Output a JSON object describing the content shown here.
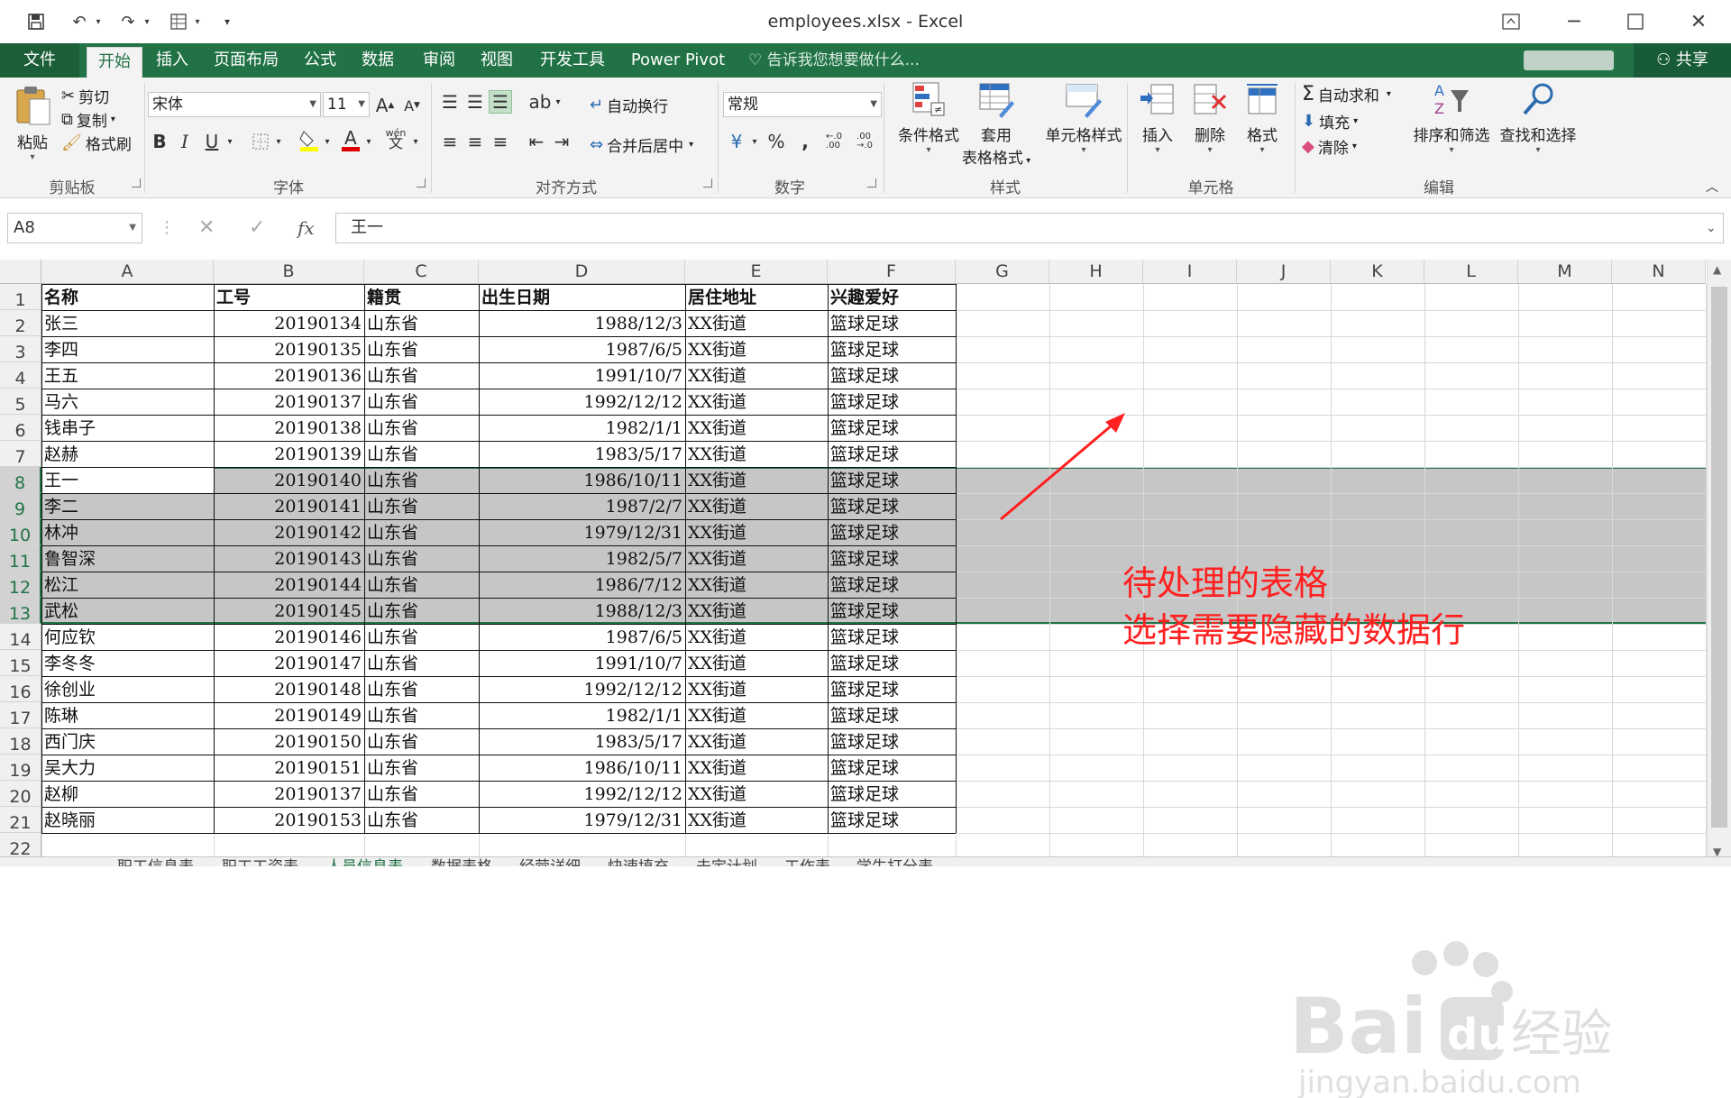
{
  "window": {
    "title": "employees.xlsx - Excel"
  },
  "tabs": [
    {
      "label": "文件"
    },
    {
      "label": "开始"
    },
    {
      "label": "插入"
    },
    {
      "label": "页面布局"
    },
    {
      "label": "公式"
    },
    {
      "label": "数据"
    },
    {
      "label": "审阅"
    },
    {
      "label": "视图"
    },
    {
      "label": "开发工具"
    },
    {
      "label": "Power Pivot"
    }
  ],
  "tell_me": "告诉我您想要做什么...",
  "share_label": "共享",
  "ribbon": {
    "clipboard": {
      "group": "剪贴板",
      "paste": "粘贴",
      "cut": "剪切",
      "copy": "复制",
      "format_painter": "格式刷"
    },
    "font": {
      "group": "字体",
      "font_name": "宋体",
      "font_size": "11",
      "bold": "B",
      "italic": "I",
      "underline": "U",
      "phonetic": "wén"
    },
    "alignment": {
      "group": "对齐方式",
      "wrap": "自动换行",
      "merge": "合并后居中"
    },
    "number": {
      "group": "数字",
      "format": "常规",
      "percent": "%",
      "comma": ","
    },
    "styles": {
      "group": "样式",
      "conditional": "条件格式",
      "table_line1": "套用",
      "table_line2": "表格格式",
      "cell_styles": "单元格样式"
    },
    "cells": {
      "group": "单元格",
      "insert": "插入",
      "delete": "删除",
      "format": "格式"
    },
    "editing": {
      "group": "编辑",
      "autosum": "自动求和",
      "fill": "填充",
      "clear": "清除",
      "sort": "排序和筛选",
      "find": "查找和选择"
    }
  },
  "formula_bar": {
    "name_box": "A8",
    "fx": "fx",
    "content": "王一"
  },
  "columns": [
    "A",
    "B",
    "C",
    "D",
    "E",
    "F",
    "G",
    "H",
    "I",
    "J",
    "K",
    "L",
    "M",
    "N"
  ],
  "row_numbers": [
    "1",
    "2",
    "3",
    "4",
    "5",
    "6",
    "7",
    "8",
    "9",
    "10",
    "11",
    "12",
    "13",
    "14",
    "15",
    "16",
    "17",
    "18",
    "19",
    "20",
    "21",
    "22"
  ],
  "table": {
    "headers": [
      "名称",
      "工号",
      "籍贯",
      "出生日期",
      "居住地址",
      "兴趣爱好"
    ],
    "rows": [
      [
        "张三",
        "20190134",
        "山东省",
        "1988/12/3",
        "XX街道",
        "篮球足球"
      ],
      [
        "李四",
        "20190135",
        "山东省",
        "1987/6/5",
        "XX街道",
        "篮球足球"
      ],
      [
        "王五",
        "20190136",
        "山东省",
        "1991/10/7",
        "XX街道",
        "篮球足球"
      ],
      [
        "马六",
        "20190137",
        "山东省",
        "1992/12/12",
        "XX街道",
        "篮球足球"
      ],
      [
        "钱串子",
        "20190138",
        "山东省",
        "1982/1/1",
        "XX街道",
        "篮球足球"
      ],
      [
        "赵赫",
        "20190139",
        "山东省",
        "1983/5/17",
        "XX街道",
        "篮球足球"
      ],
      [
        "王一",
        "20190140",
        "山东省",
        "1986/10/11",
        "XX街道",
        "篮球足球"
      ],
      [
        "李二",
        "20190141",
        "山东省",
        "1987/2/7",
        "XX街道",
        "篮球足球"
      ],
      [
        "林冲",
        "20190142",
        "山东省",
        "1979/12/31",
        "XX街道",
        "篮球足球"
      ],
      [
        "鲁智深",
        "20190143",
        "山东省",
        "1982/5/7",
        "XX街道",
        "篮球足球"
      ],
      [
        "松江",
        "20190144",
        "山东省",
        "1986/7/12",
        "XX街道",
        "篮球足球"
      ],
      [
        "武松",
        "20190145",
        "山东省",
        "1988/12/3",
        "XX街道",
        "篮球足球"
      ],
      [
        "何应钦",
        "20190146",
        "山东省",
        "1987/6/5",
        "XX街道",
        "篮球足球"
      ],
      [
        "李冬冬",
        "20190147",
        "山东省",
        "1991/10/7",
        "XX街道",
        "篮球足球"
      ],
      [
        "徐创业",
        "20190148",
        "山东省",
        "1992/12/12",
        "XX街道",
        "篮球足球"
      ],
      [
        "陈琳",
        "20190149",
        "山东省",
        "1982/1/1",
        "XX街道",
        "篮球足球"
      ],
      [
        "西门庆",
        "20190150",
        "山东省",
        "1983/5/17",
        "XX街道",
        "篮球足球"
      ],
      [
        "吴大力",
        "20190151",
        "山东省",
        "1986/10/11",
        "XX街道",
        "篮球足球"
      ],
      [
        "赵柳",
        "20190137",
        "山东省",
        "1992/12/12",
        "XX街道",
        "篮球足球"
      ],
      [
        "赵晓丽",
        "20190153",
        "山东省",
        "1979/12/31",
        "XX街道",
        "篮球足球"
      ]
    ]
  },
  "selection": {
    "first_row": 8,
    "last_row": 13,
    "active_cell": "A8"
  },
  "annotation": {
    "line1": "待处理的表格",
    "line2": "选择需要隐藏的数据行",
    "color": "#ff2020"
  },
  "sheet_tabs": [
    "职工信息表",
    "职工工资表",
    "人员信息表",
    "数据表格",
    "经营详细",
    "快速填充",
    "未定计划",
    "工作表",
    "学生打分表"
  ],
  "colors": {
    "accent": "#217346",
    "selection_fill": "#c6c6c6"
  }
}
